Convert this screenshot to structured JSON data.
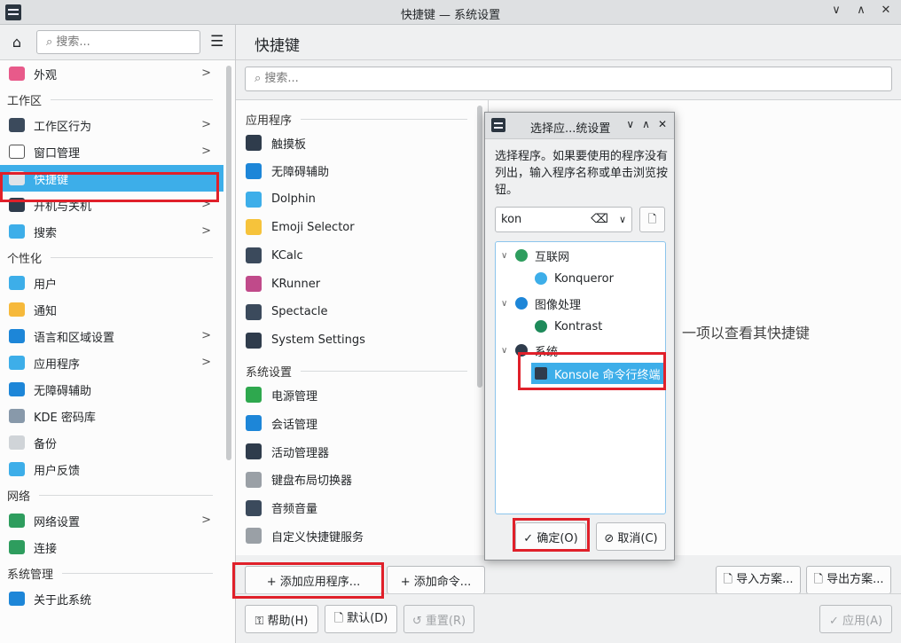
{
  "window": {
    "title": "快捷键 — 系统设置",
    "buttons": [
      "∨",
      "∧",
      "✕"
    ]
  },
  "sidebar": {
    "search_placeholder": "搜索...",
    "items": [
      {
        "label": "外观",
        "chev": true,
        "color": "#e85a8a"
      },
      {
        "section": "工作区"
      },
      {
        "label": "工作区行为",
        "chev": true,
        "color": "#3b4a5c"
      },
      {
        "label": "窗口管理",
        "chev": true,
        "color": "#ffffff"
      },
      {
        "label": "快捷键",
        "chev": false,
        "color": "#dfe3e8",
        "active": true
      },
      {
        "label": "开机与关机",
        "chev": true,
        "color": "#2f3c4c"
      },
      {
        "label": "搜索",
        "chev": true,
        "color": "#3daee9"
      },
      {
        "section": "个性化"
      },
      {
        "label": "用户",
        "chev": false,
        "color": "#3daee9"
      },
      {
        "label": "通知",
        "chev": false,
        "color": "#f6b93b"
      },
      {
        "label": "语言和区域设置",
        "chev": true,
        "color": "#1d86d8"
      },
      {
        "label": "应用程序",
        "chev": true,
        "color": "#3daee9"
      },
      {
        "label": "无障碍辅助",
        "chev": false,
        "color": "#1d86d8"
      },
      {
        "label": "KDE 密码库",
        "chev": false,
        "color": "#8899aa"
      },
      {
        "label": "备份",
        "chev": false,
        "color": "#d0d4d8"
      },
      {
        "label": "用户反馈",
        "chev": false,
        "color": "#3daee9"
      },
      {
        "section": "网络"
      },
      {
        "label": "网络设置",
        "chev": true,
        "color": "#2e9d5e"
      },
      {
        "label": "连接",
        "chev": false,
        "color": "#2e9d5e"
      },
      {
        "section": "系统管理"
      },
      {
        "label": "关于此系统",
        "chev": false,
        "color": "#1d86d8"
      }
    ]
  },
  "main": {
    "title": "快捷键",
    "search_placeholder": "搜索...",
    "detail_text": "一项以查看其快捷键",
    "sections": [
      {
        "label": "应用程序",
        "items": [
          {
            "label": "触摸板",
            "color": "#2f3c4c"
          },
          {
            "label": "无障碍辅助",
            "color": "#1d86d8"
          },
          {
            "label": "Dolphin",
            "color": "#3daee9"
          },
          {
            "label": "Emoji Selector",
            "color": "#f6c33b"
          },
          {
            "label": "KCalc",
            "color": "#3b4a5c"
          },
          {
            "label": "KRunner",
            "color": "#c04a8a"
          },
          {
            "label": "Spectacle",
            "color": "#3b4a5c"
          },
          {
            "label": "System Settings",
            "color": "#2f3c4c"
          }
        ]
      },
      {
        "label": "系统设置",
        "items": [
          {
            "label": "电源管理",
            "color": "#2ea84e"
          },
          {
            "label": "会话管理",
            "color": "#1d86d8"
          },
          {
            "label": "活动管理器",
            "color": "#2f3c4c"
          },
          {
            "label": "键盘布局切换器",
            "color": "#9aa0a6"
          },
          {
            "label": "音频音量",
            "color": "#3b4a5c"
          },
          {
            "label": "自定义快捷键服务",
            "color": "#9aa0a6"
          }
        ]
      }
    ],
    "buttons": {
      "add_app": "+ 添加应用程序...",
      "add_cmd": "+ 添加命令...",
      "import": "🗋 导入方案...",
      "export": "🗋 导出方案...",
      "help": "⚿ 帮助(H)",
      "defaults": "🗋 默认(D)",
      "reset": "↺ 重置(R)",
      "apply": "✓ 应用(A)"
    }
  },
  "dialog": {
    "title": "选择应...统设置",
    "buttons": [
      "∨",
      "∧",
      "✕"
    ],
    "message": "选择程序。如果要使用的程序没有列出，输入程序名称或单击浏览按钮。",
    "input_value": "kon",
    "tree": [
      {
        "label": "互联网",
        "level": 0,
        "expander": "∨",
        "color": "#2e9d5e"
      },
      {
        "label": "Konqueror",
        "level": 1,
        "color": "#3daee9"
      },
      {
        "label": "图像处理",
        "level": 0,
        "expander": "∨",
        "color": "#1d86d8"
      },
      {
        "label": "Kontrast",
        "level": 1,
        "color": "#1e8a5a"
      },
      {
        "label": "系统",
        "level": 0,
        "expander": "∨",
        "color": "#2f3c4c"
      },
      {
        "label": "Konsole 命令行终端",
        "level": 1,
        "color": "#2f3c4c",
        "selected": true
      }
    ],
    "ok": "✓ 确定(O)",
    "cancel": "⊘ 取消(C)"
  }
}
